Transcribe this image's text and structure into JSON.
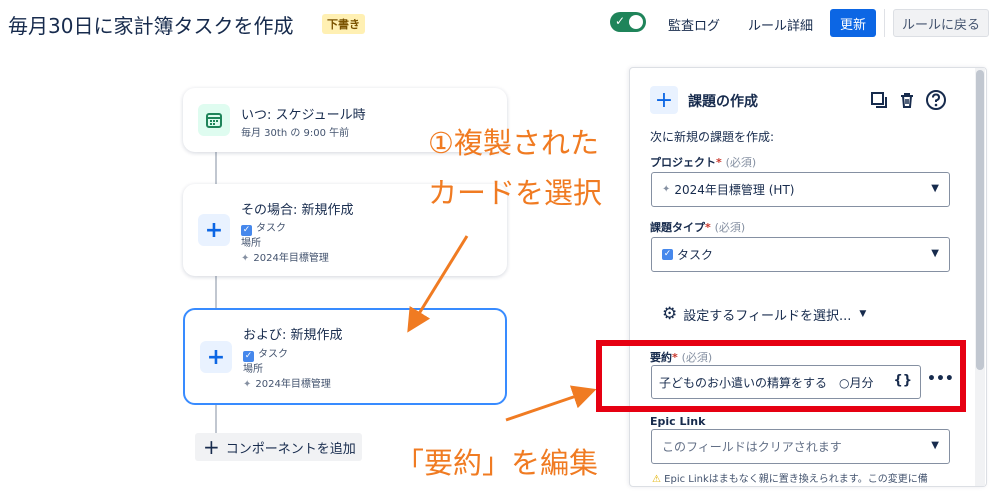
{
  "header": {
    "title": "毎月30日に家計簿タスクを作成",
    "draft_badge": "下書き",
    "audit_log": "監査ログ",
    "rule_details": "ルール詳細",
    "update": "更新",
    "back_to_rules": "ルールに戻る",
    "toggle_enabled": true
  },
  "cards": [
    {
      "title": "いつ: スケジュール時",
      "detail": "毎月 30th の 9:00 午前"
    },
    {
      "title": "その場合: 新規作成",
      "issue_type": "タスク",
      "location_label": "場所",
      "project": "2024年目標管理"
    },
    {
      "title": "および: 新規作成",
      "issue_type": "タスク",
      "location_label": "場所",
      "project": "2024年目標管理"
    }
  ],
  "add_component": "コンポーネントを追加",
  "annotations": {
    "step1_line1": "①複製された",
    "step1_line2": "カードを選択",
    "step2": "「要約」を編集"
  },
  "panel": {
    "title": "課題の作成",
    "intro": "次に新規の課題を作成:",
    "project_label": "プロジェクト",
    "required_mark": "*",
    "required_note": "(必須)",
    "project_value": "2024年目標管理 (HT)",
    "issue_type_label": "課題タイプ",
    "issue_type_value": "タスク",
    "field_config": "設定するフィールドを選択...",
    "summary_label": "要約",
    "summary_value": "子どものお小遣いの精算をする　○月分",
    "summary_braces": "{}",
    "more": "•••",
    "epic_label": "Epic Link",
    "epic_value": "このフィールドはクリアされます",
    "epic_warning": "Epic Linkはまもなく親に置き換えられます。この変更に備"
  },
  "colors": {
    "accent_blue": "#0c66e4",
    "annotation_orange": "#f07b22",
    "highlight_red": "#e60012",
    "toggle_green": "#1f845a"
  }
}
